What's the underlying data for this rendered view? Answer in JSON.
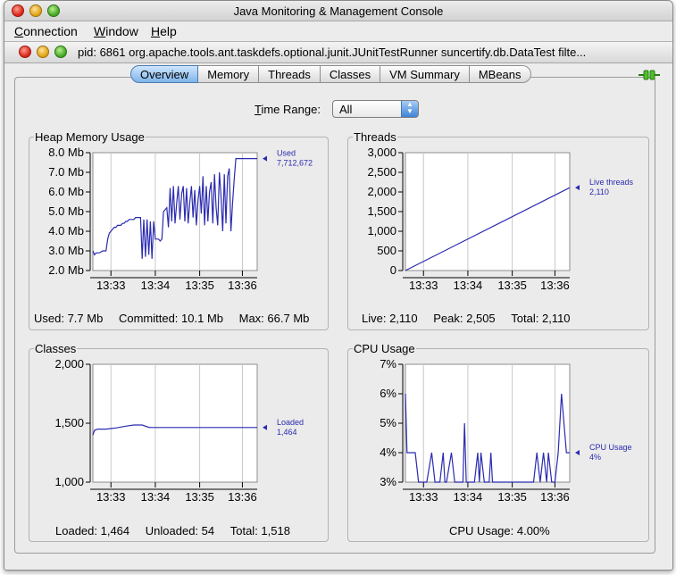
{
  "window": {
    "title": "Java Monitoring & Management Console"
  },
  "menubar": {
    "items": [
      {
        "label": "Connection",
        "underline": "C"
      },
      {
        "label": "Window",
        "underline": "W"
      },
      {
        "label": "Help",
        "underline": "H"
      }
    ]
  },
  "frame": {
    "title": "pid: 6861 org.apache.tools.ant.taskdefs.optional.junit.JUnitTestRunner suncertify.db.DataTest filte..."
  },
  "tabs": [
    {
      "label": "Overview",
      "active": true
    },
    {
      "label": "Memory",
      "active": false
    },
    {
      "label": "Threads",
      "active": false
    },
    {
      "label": "Classes",
      "active": false
    },
    {
      "label": "VM Summary",
      "active": false
    },
    {
      "label": "MBeans",
      "active": false
    }
  ],
  "time_range": {
    "label_u": "T",
    "label_rest": "ime Range:",
    "value": "All"
  },
  "colors": {
    "series": "#2b2bb0",
    "tab_active": "#8fbfee"
  },
  "panels": {
    "heap": {
      "title": "Heap Memory Usage",
      "stats": {
        "used": "Used: 7.7 Mb",
        "committed": "Committed: 10.1 Mb",
        "max": "Max: 66.7 Mb"
      }
    },
    "threads": {
      "title": "Threads",
      "stats": {
        "live": "Live: 2,110",
        "peak": "Peak: 2,505",
        "total": "Total: 2,110"
      }
    },
    "classes": {
      "title": "Classes",
      "stats": {
        "loaded": "Loaded: 1,464",
        "unloaded": "Unloaded: 54",
        "total": "Total: 1,518"
      }
    },
    "cpu": {
      "title": "CPU Usage",
      "stats": {
        "usage": "CPU Usage: 4.00%"
      }
    }
  },
  "chart_data": [
    {
      "id": "heap",
      "type": "line",
      "x_ticks": [
        "13:33",
        "13:34",
        "13:35",
        "13:36"
      ],
      "y_ticks": [
        "2.0 Mb",
        "3.0 Mb",
        "4.0 Mb",
        "5.0 Mb",
        "6.0 Mb",
        "7.0 Mb",
        "8.0 Mb"
      ],
      "ylim": [
        2.0,
        8.0
      ],
      "xlim": [
        0,
        100
      ],
      "series": [
        {
          "name": "Used",
          "legend_value": "7,712,672",
          "x": [
            0,
            1,
            2,
            4,
            6,
            8,
            9,
            10,
            11,
            12,
            13,
            14,
            15,
            16,
            17,
            18,
            19,
            20,
            21,
            22,
            23,
            24,
            25,
            26,
            27,
            28,
            29,
            30,
            31,
            32,
            33,
            34,
            35,
            36,
            37,
            38,
            39,
            40,
            41,
            42,
            43,
            44,
            45,
            46,
            47,
            48,
            49,
            50,
            51,
            52,
            53,
            54,
            55,
            56,
            57,
            58,
            59,
            60,
            61,
            62,
            63,
            64,
            65,
            66,
            67,
            68,
            69,
            70,
            71,
            72,
            73,
            74,
            75,
            76,
            77,
            78,
            79,
            80,
            81,
            82,
            83,
            84,
            85,
            86,
            87,
            88,
            89,
            90,
            91,
            92,
            93,
            94,
            95,
            96,
            97,
            98,
            99,
            100
          ],
          "y": [
            3.0,
            2.8,
            2.9,
            2.9,
            3.0,
            3.0,
            3.6,
            3.9,
            4.0,
            4.1,
            4.2,
            4.2,
            4.3,
            4.3,
            4.3,
            4.4,
            4.4,
            4.5,
            4.5,
            4.6,
            4.6,
            4.6,
            4.6,
            4.7,
            4.7,
            4.7,
            4.7,
            2.6,
            4.6,
            2.7,
            4.6,
            2.8,
            4.5,
            2.6,
            4.5,
            3.6,
            3.6,
            3.6,
            3.5,
            3.6,
            5.0,
            5.1,
            5.2,
            4.2,
            6.2,
            4.5,
            6.3,
            4.4,
            5.4,
            6.3,
            4.6,
            5.9,
            6.3,
            4.5,
            6.2,
            4.4,
            5.5,
            6.3,
            4.7,
            6.1,
            4.3,
            5.6,
            6.3,
            4.9,
            6.8,
            4.3,
            6.3,
            4.5,
            6.0,
            6.5,
            4.4,
            6.9,
            5.2,
            4.3,
            7.0,
            5.8,
            4.0,
            6.9,
            4.4,
            6.8,
            7.2,
            4.0,
            5.4,
            6.6,
            7.7,
            7.7,
            7.7,
            7.7,
            7.7,
            7.7,
            7.7,
            7.7,
            7.7,
            7.7,
            7.7,
            7.7,
            7.7,
            7.7
          ]
        }
      ]
    },
    {
      "id": "threads",
      "type": "line",
      "x_ticks": [
        "13:33",
        "13:34",
        "13:35",
        "13:36"
      ],
      "y_ticks": [
        "0",
        "500",
        "1,000",
        "1,500",
        "2,000",
        "2,500",
        "3,000"
      ],
      "ylim": [
        0,
        3000
      ],
      "xlim": [
        0,
        100
      ],
      "series": [
        {
          "name": "Live threads",
          "legend_value": "2,110",
          "x": [
            0,
            100
          ],
          "y": [
            0,
            2110
          ]
        }
      ]
    },
    {
      "id": "classes",
      "type": "line",
      "x_ticks": [
        "13:33",
        "13:34",
        "13:35",
        "13:36"
      ],
      "y_ticks": [
        "1,000",
        "1,500",
        "2,000"
      ],
      "ylim": [
        1000,
        2000
      ],
      "xlim": [
        0,
        100
      ],
      "series": [
        {
          "name": "Loaded",
          "legend_value": "1,464",
          "x": [
            0,
            1,
            3,
            8,
            14,
            20,
            25,
            28,
            30,
            34,
            36,
            100
          ],
          "y": [
            1400,
            1440,
            1450,
            1450,
            1460,
            1475,
            1485,
            1485,
            1485,
            1465,
            1464,
            1464
          ]
        }
      ]
    },
    {
      "id": "cpu",
      "type": "line",
      "x_ticks": [
        "13:33",
        "13:34",
        "13:35",
        "13:36"
      ],
      "y_ticks": [
        "3%",
        "4%",
        "5%",
        "6%",
        "7%"
      ],
      "ylim": [
        3,
        7
      ],
      "xlim": [
        0,
        100
      ],
      "series": [
        {
          "name": "CPU Usage",
          "legend_value": "4%",
          "x": [
            0,
            1,
            2,
            3,
            6,
            8,
            10,
            13,
            16,
            18,
            19,
            21,
            23,
            24,
            25,
            28,
            30,
            31,
            35,
            36,
            37,
            38,
            39,
            40,
            41,
            42,
            44,
            45,
            46,
            48,
            51,
            52,
            53,
            60,
            61,
            62,
            63,
            65,
            66,
            68,
            69,
            71,
            73,
            75,
            76,
            78,
            80,
            82,
            84,
            86,
            87,
            89,
            91,
            93,
            95,
            98,
            100
          ],
          "y": [
            6,
            4,
            4,
            4,
            4,
            3,
            3,
            3,
            4,
            3,
            3,
            3,
            4,
            3,
            3,
            4,
            3,
            3,
            3,
            5,
            3,
            3,
            3,
            3,
            3,
            3,
            4,
            3,
            4,
            3,
            3,
            4,
            3,
            3,
            3,
            3,
            3,
            3,
            3,
            3,
            3,
            3,
            3,
            3,
            3,
            3,
            4,
            3,
            4,
            3,
            4,
            3,
            3,
            4,
            6,
            4,
            4
          ]
        }
      ]
    }
  ]
}
